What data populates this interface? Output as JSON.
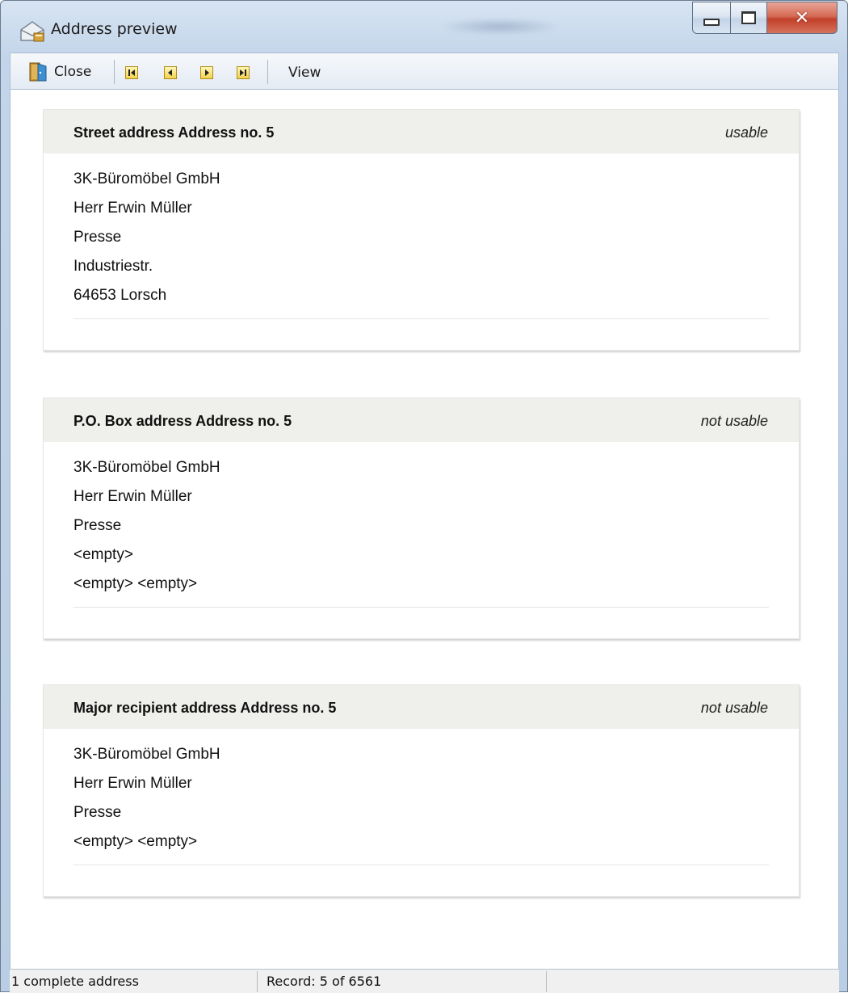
{
  "window": {
    "title": "Address preview",
    "controls": {
      "minimize": "minimize",
      "maximize": "maximize",
      "close": "close"
    }
  },
  "toolbar": {
    "close_label": "Close",
    "view_label": "View",
    "nav": [
      "first-record",
      "previous-record",
      "next-record",
      "last-record"
    ]
  },
  "cards": [
    {
      "title": "Street address Address no. 5",
      "status": "usable",
      "lines": [
        "3K-Büromöbel GmbH",
        "Herr Erwin Müller",
        "Presse",
        "Industriestr.",
        "64653 Lorsch"
      ]
    },
    {
      "title": "P.O. Box address Address no. 5",
      "status": "not usable",
      "lines": [
        "3K-Büromöbel GmbH",
        "Herr Erwin Müller",
        "Presse",
        "<empty>",
        "<empty> <empty>"
      ]
    },
    {
      "title": "Major recipient address Address no. 5",
      "status": "not usable",
      "lines": [
        "3K-Büromöbel GmbH",
        "Herr Erwin Müller",
        "Presse",
        "<empty> <empty>"
      ]
    }
  ],
  "statusbar": {
    "complete": "1 complete address",
    "record": "Record: 5 of 6561"
  },
  "colors": {
    "card_header": "#efefeb",
    "nav_button": "#f2d34d",
    "close_button": "#c2402a"
  }
}
